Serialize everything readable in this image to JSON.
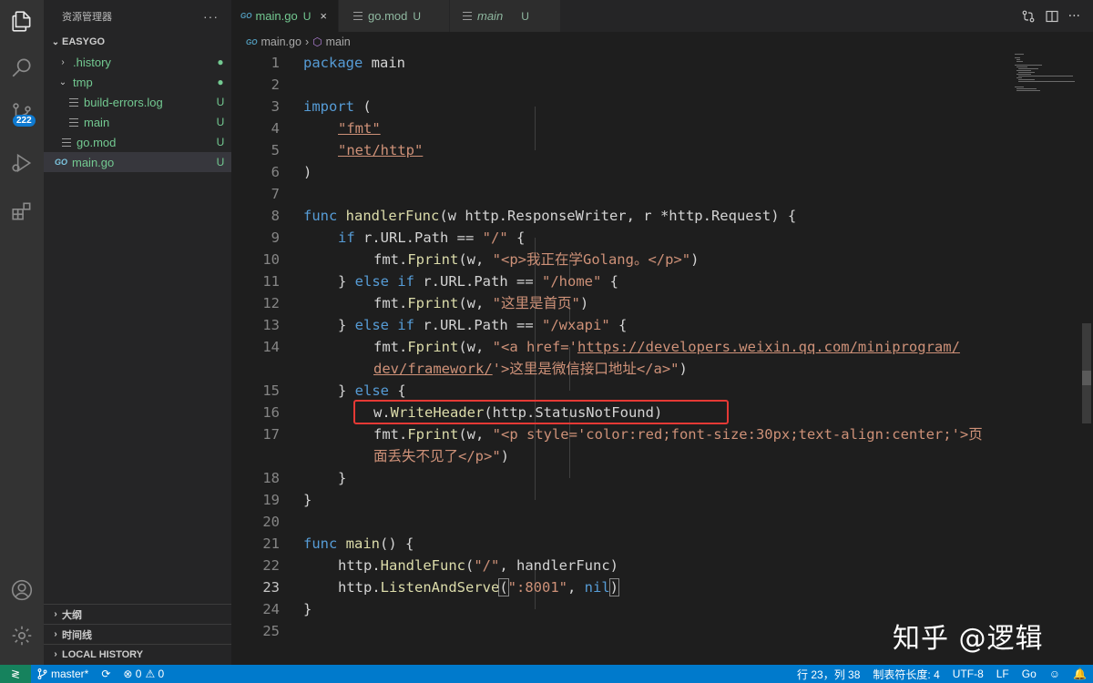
{
  "activity": {
    "scm_badge": "222",
    "icons": [
      "explorer-icon",
      "search-icon",
      "source-control-icon",
      "run-debug-icon",
      "extensions-icon",
      "account-icon",
      "settings-gear-icon"
    ]
  },
  "sidebar": {
    "title": "资源管理器",
    "more": "···",
    "root": "EASYGO",
    "items": [
      {
        "label": ".history",
        "status": "●"
      },
      {
        "label": "tmp",
        "status": "●"
      },
      {
        "label": "build-errors.log",
        "status": "U"
      },
      {
        "label": "main",
        "status": "U"
      },
      {
        "label": "go.mod",
        "status": "U"
      },
      {
        "label": "main.go",
        "status": "U"
      }
    ],
    "go_prefix": "GO",
    "sections": [
      "大纲",
      "时间线",
      "LOCAL HISTORY"
    ]
  },
  "tabs": [
    {
      "label": "main.go",
      "status": "U",
      "close": "×"
    },
    {
      "label": "go.mod",
      "status": "U"
    },
    {
      "label": "main",
      "status": "U"
    }
  ],
  "breadcrumb": {
    "file": "main.go",
    "sep": "›",
    "symbol": "main"
  },
  "editor": {
    "lines": [
      {
        "n": "1"
      },
      {
        "n": "2"
      },
      {
        "n": "3"
      },
      {
        "n": "4"
      },
      {
        "n": "5"
      },
      {
        "n": "6"
      },
      {
        "n": "7"
      },
      {
        "n": "8"
      },
      {
        "n": "9"
      },
      {
        "n": "10"
      },
      {
        "n": "11"
      },
      {
        "n": "12"
      },
      {
        "n": "13"
      },
      {
        "n": "14"
      },
      {
        "n": ""
      },
      {
        "n": "15"
      },
      {
        "n": "16"
      },
      {
        "n": "17"
      },
      {
        "n": ""
      },
      {
        "n": "18"
      },
      {
        "n": "19"
      },
      {
        "n": "20"
      },
      {
        "n": "21"
      },
      {
        "n": "22"
      },
      {
        "n": "23"
      },
      {
        "n": "24"
      },
      {
        "n": "25"
      }
    ],
    "current_line": "23",
    "code": {
      "l1": [
        "package",
        " main"
      ],
      "l3": [
        "import",
        " ("
      ],
      "l4": "\"fmt\"",
      "l5": "\"net/http\"",
      "l6": ")",
      "l8": [
        "func",
        " ",
        "handlerFunc",
        "(w http.ResponseWriter, r *http.Request) {"
      ],
      "l9": [
        "if",
        " r.URL.Path == ",
        "\"/\"",
        " {"
      ],
      "l10": [
        "fmt.",
        "Fprint",
        "(w, ",
        "\"<p>我正在学Golang。</p>\"",
        ")"
      ],
      "l11": [
        "} ",
        "else",
        " ",
        "if",
        " r.URL.Path == ",
        "\"/home\"",
        " {"
      ],
      "l12": [
        "fmt.",
        "Fprint",
        "(w, ",
        "\"这里是首页\"",
        ")"
      ],
      "l13": [
        "} ",
        "else",
        " ",
        "if",
        " r.URL.Path == ",
        "\"/wxapi\"",
        " {"
      ],
      "l14": [
        "fmt.",
        "Fprint",
        "(w, ",
        "\"<a href='",
        "https://developers.weixin.qq.com/miniprogram/"
      ],
      "l14b": [
        "dev/framework/",
        "'>这里是微信接口地址</a>\"",
        ")"
      ],
      "l15": [
        "} ",
        "else",
        " {"
      ],
      "l16": [
        "w.",
        "WriteHeader",
        "(http.StatusNotFound)"
      ],
      "l17": [
        "fmt.",
        "Fprint",
        "(w, ",
        "\"<p style='color:red;font-size:30px;text-align:center;'>页"
      ],
      "l17b": [
        "面丢失不见了</p>\"",
        ")"
      ],
      "l18": "}",
      "l19": "}",
      "l21": [
        "func",
        " ",
        "main",
        "() {"
      ],
      "l22": [
        "http.",
        "HandleFunc",
        "(",
        "\"/\"",
        ", handlerFunc)"
      ],
      "l23": [
        "http.",
        "ListenAndServe",
        "(",
        "\":8001\"",
        ", ",
        "nil",
        ")"
      ],
      "l24": "}"
    }
  },
  "watermark": "知乎 @逻辑",
  "statusbar": {
    "remote": "≷",
    "branch": "master*",
    "sync": "⟳",
    "errors": "⊗ 0",
    "warnings": "⚠ 0",
    "position": "行 23，列 38",
    "tabsize": "制表符长度: 4",
    "encoding": "UTF-8",
    "eol": "LF",
    "language": "Go",
    "feedback": "☺",
    "notifications": "🔔"
  },
  "colors": {
    "accent": "#007acc",
    "untracked": "#73c991",
    "highlight_box": "#e53935"
  }
}
